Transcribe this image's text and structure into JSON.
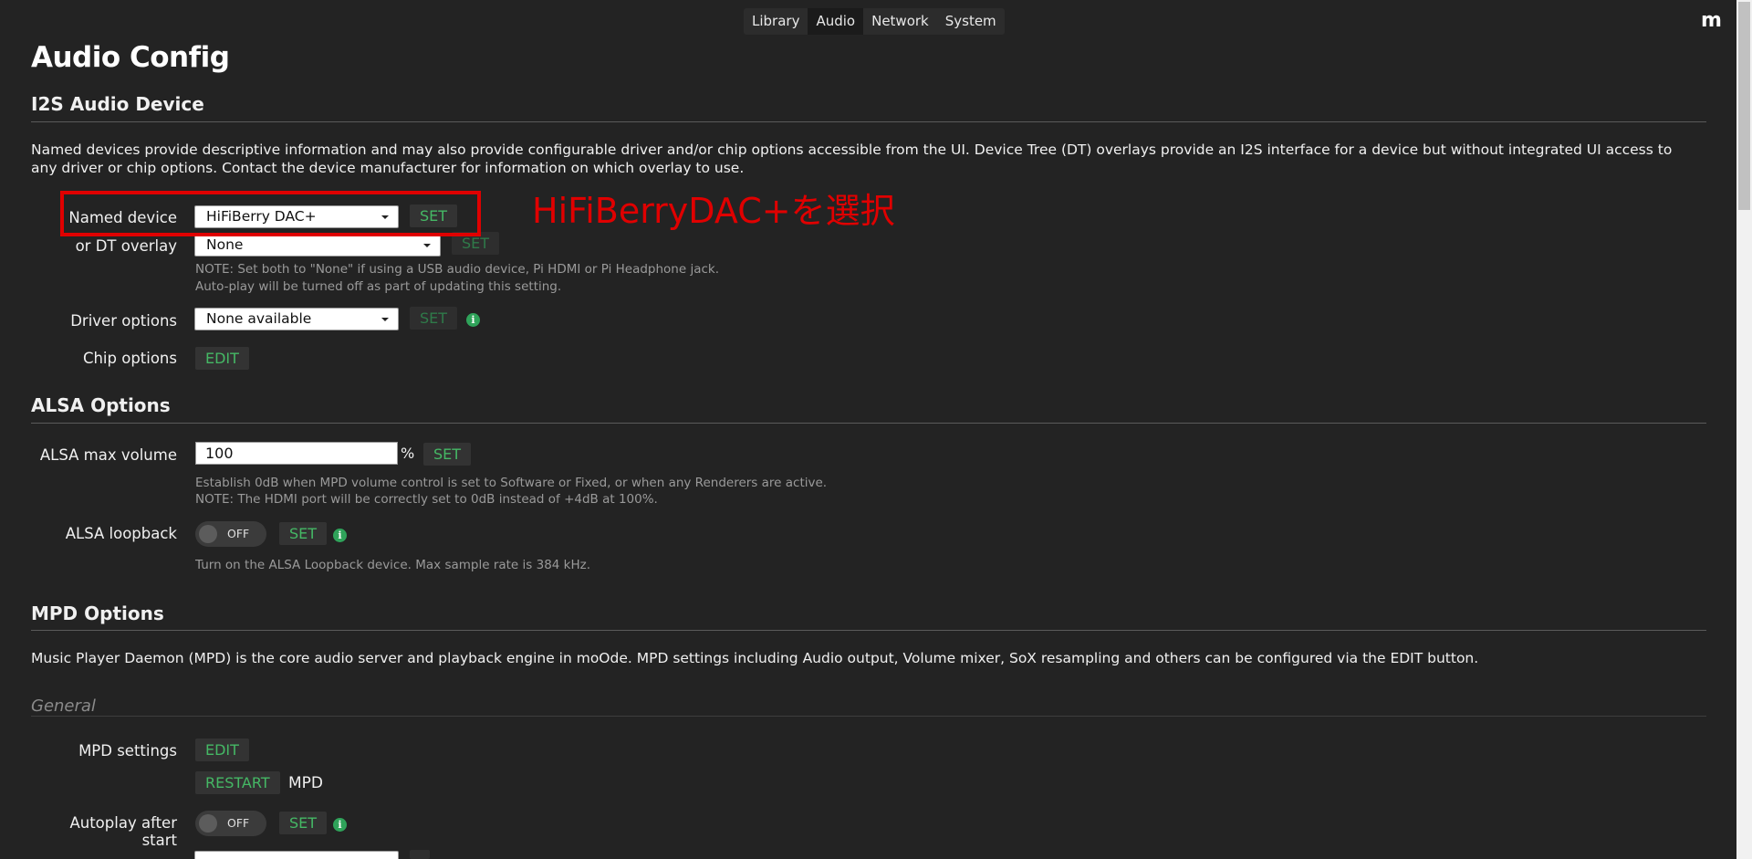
{
  "nav": {
    "tabs": [
      {
        "label": "Library"
      },
      {
        "label": "Audio"
      },
      {
        "label": "Network"
      },
      {
        "label": "System"
      }
    ],
    "logo": "m"
  },
  "page": {
    "title": "Audio Config"
  },
  "i2s": {
    "title": "I2S Audio Device",
    "description": "Named devices provide descriptive information and may also provide configurable driver and/or chip options accessible from the UI. Device Tree (DT) overlays provide an I2S interface for a device but without integrated UI access to any driver or chip options. Contact the device manufacturer for information on which overlay to use.",
    "named_device": {
      "label": "Named device",
      "value": "HiFiBerry DAC+",
      "button": "SET"
    },
    "dt_overlay": {
      "label": "or DT overlay",
      "value": "None",
      "button": "SET"
    },
    "note_1": "NOTE: Set both to \"None\" if using a USB audio device, Pi HDMI or Pi Headphone jack.",
    "note_2": "Auto-play will be turned off as part of updating this setting.",
    "driver_options": {
      "label": "Driver options",
      "value": "None available",
      "button": "SET"
    },
    "chip_options": {
      "label": "Chip options",
      "button": "EDIT"
    }
  },
  "annotation": "HiFiBerryDAC+を選択",
  "alsa": {
    "title": "ALSA Options",
    "max_volume": {
      "label": "ALSA max volume",
      "value": "100",
      "unit": "%",
      "button": "SET"
    },
    "help_1": "Establish 0dB when MPD volume control is set to Software or Fixed, or when any Renderers are active.",
    "help_2": "NOTE: The HDMI port will be correctly set to 0dB instead of +4dB at 100%.",
    "loopback": {
      "label": "ALSA loopback",
      "toggle": "OFF",
      "button": "SET"
    },
    "loopback_help": "Turn on the ALSA Loopback device. Max sample rate is 384 kHz."
  },
  "mpd": {
    "title": "MPD Options",
    "description": "Music Player Daemon (MPD) is the core audio server and playback engine in moOde. MPD settings including Audio output, Volume mixer, SoX resampling and others can be configured via the EDIT button.",
    "general_title": "General",
    "settings": {
      "label": "MPD settings",
      "button": "EDIT"
    },
    "restart": {
      "button": "RESTART",
      "suffix": "MPD"
    },
    "autoplay": {
      "label": "Autoplay after start",
      "toggle": "OFF",
      "button": "SET"
    }
  },
  "icons": {
    "info": "i"
  }
}
